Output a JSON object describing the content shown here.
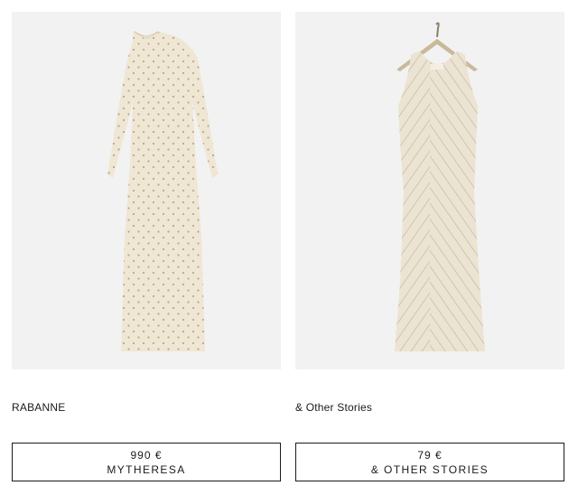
{
  "products": [
    {
      "brand": "RABANNE",
      "price": "990 €",
      "store": "MYTHERESA",
      "image_description_icon": "long-sleeve-studded-dress-image"
    },
    {
      "brand": "& Other Stories",
      "price": "79 €",
      "store": "& OTHER STORIES",
      "image_description_icon": "crochet-sleeveless-dress-image"
    }
  ],
  "colors": {
    "image_background": "#f2f2f2",
    "dress_fill": "#efe6d4",
    "text": "#1a1a1a",
    "border": "#1a1a1a"
  }
}
